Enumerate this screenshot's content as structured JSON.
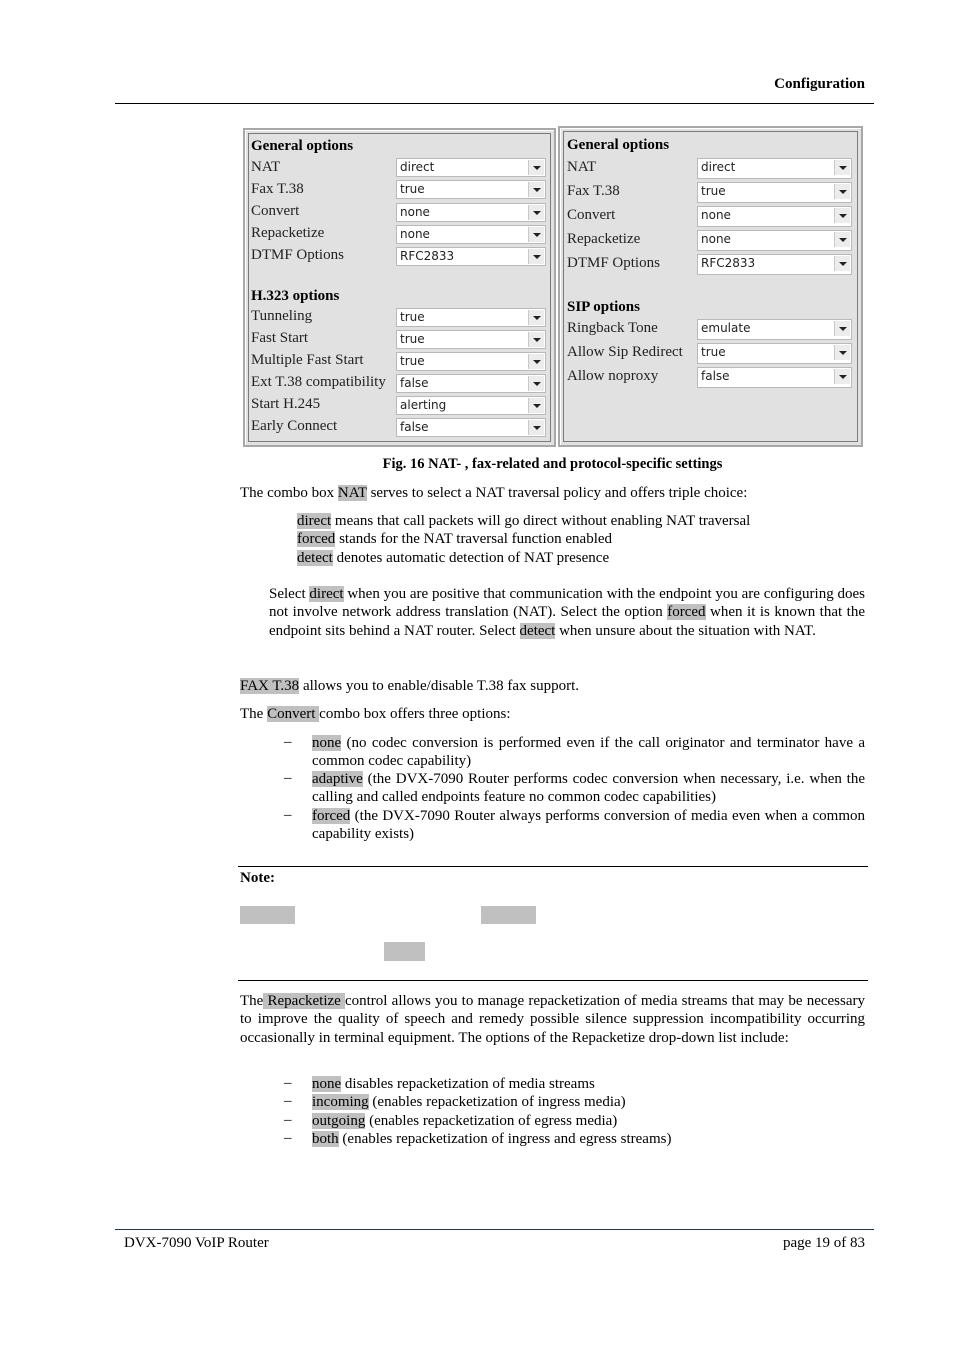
{
  "header": {
    "section_title": "Configuration"
  },
  "figure": {
    "caption": "Fig. 16 NAT- , fax-related and protocol-specific settings",
    "left_panel": {
      "general_title": "General options",
      "general": [
        {
          "label": "NAT",
          "value": "direct"
        },
        {
          "label": "Fax T.38",
          "value": "true"
        },
        {
          "label": "Convert",
          "value": "none"
        },
        {
          "label": "Repacketize",
          "value": "none"
        },
        {
          "label": "DTMF Options",
          "value": "RFC2833"
        }
      ],
      "protocol_title": "H.323 options",
      "protocol": [
        {
          "label": "Tunneling",
          "value": "true"
        },
        {
          "label": "Fast Start",
          "value": "true"
        },
        {
          "label": "Multiple Fast Start",
          "value": "true"
        },
        {
          "label": "Ext T.38 compatibility",
          "value": "false"
        },
        {
          "label": "Start H.245",
          "value": "alerting"
        },
        {
          "label": "Early Connect",
          "value": "false"
        }
      ]
    },
    "right_panel": {
      "general_title": "General options",
      "general": [
        {
          "label": "NAT",
          "value": "direct"
        },
        {
          "label": "Fax T.38",
          "value": "true"
        },
        {
          "label": "Convert",
          "value": "none"
        },
        {
          "label": "Repacketize",
          "value": "none"
        },
        {
          "label": "DTMF Options",
          "value": "RFC2833"
        }
      ],
      "protocol_title": "SIP options",
      "protocol": [
        {
          "label": "Ringback Tone",
          "value": "emulate"
        },
        {
          "label": "Allow Sip Redirect",
          "value": "true"
        },
        {
          "label": "Allow noproxy",
          "value": "false"
        }
      ]
    }
  },
  "body": {
    "nat_intro": {
      "pre": "The combo box ",
      "term": "NAT",
      "post": " serves to select a NAT traversal policy and offers triple choice:"
    },
    "nat_options": [
      {
        "term": "direct",
        "text": " means that call packets will go direct without enabling NAT traversal"
      },
      {
        "term": "forced",
        "text": " stands for the NAT traversal function enabled"
      },
      {
        "term": "detect",
        "text": " denotes automatic detection of NAT presence"
      }
    ],
    "nat_select": {
      "t1": "Select ",
      "h1": "direct",
      "t2": " when you are positive that communication with the endpoint you are configuring does not involve network address translation (NAT). Select the option ",
      "h2": "forced",
      "t3": " when it is known that the endpoint sits behind a NAT router. Select ",
      "h3": "detect",
      "t4": " when unsure about the situation with NAT."
    },
    "fax": {
      "term": "FAX T.38",
      "post": " allows you to enable/disable T.38 fax support."
    },
    "convert_intro": {
      "pre": "The ",
      "term": "Convert ",
      "post": " combo box offers three options:"
    },
    "convert_options": [
      {
        "term": "none",
        "text": " (no codec conversion is performed even if the call originator and terminator have a common codec capability)"
      },
      {
        "term": "adaptive",
        "text": " (the DVX-7090 Router performs codec conversion when necessary, i.e. when the calling and called endpoints feature no common codec capabilities)"
      },
      {
        "term": "forced",
        "text": " (the DVX-7090 Router always performs conversion of media even when a common capability exists)"
      }
    ],
    "note_label": "Note:",
    "repack_intro": {
      "pre": "The",
      "term": " Repacketize ",
      "post": " control allows you to manage repacketization of media streams that may be necessary to improve the quality of speech and remedy possible silence suppression incompatibility occurring occasionally in terminal equipment. The options of the Repacketize drop-down list include:"
    },
    "repack_options": [
      {
        "term": "none",
        "text": " disables repacketization of media streams"
      },
      {
        "term": "incoming",
        "text": " (enables repacketization of ingress media)"
      },
      {
        "term": "outgoing",
        "text": " (enables repacketization of egress media)"
      },
      {
        "term": "both",
        "text": " (enables repacketization of ingress and egress streams)"
      }
    ],
    "dash": "–"
  },
  "footer": {
    "product": "DVX-7090 VoIP Router",
    "page": "page 19 of 83"
  }
}
